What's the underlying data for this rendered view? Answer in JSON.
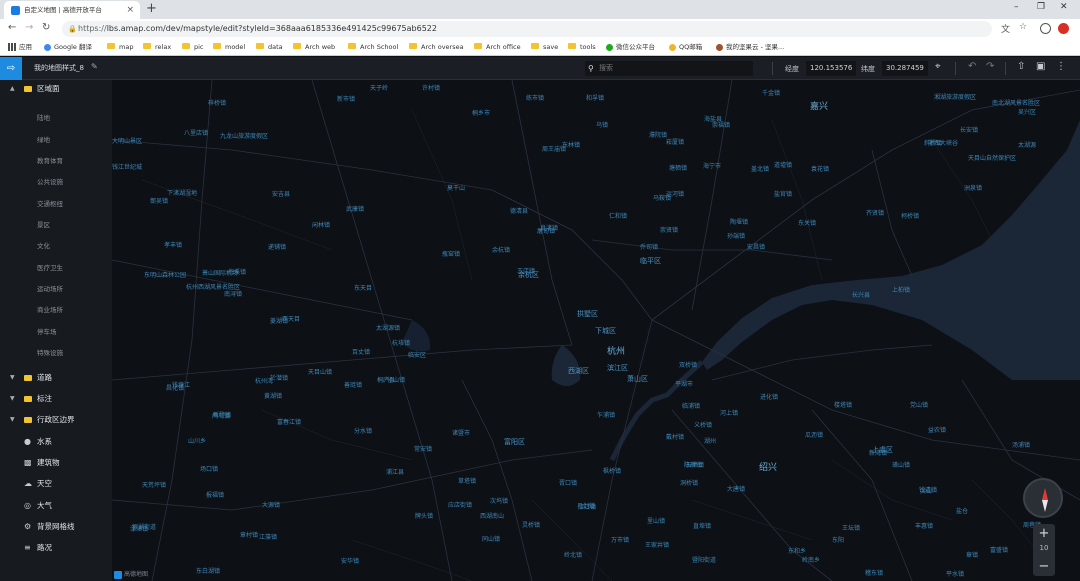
{
  "browser": {
    "tab_title": "自定义地图 | 高德开放平台",
    "tab_close": "×",
    "new_tab": "+",
    "window_controls": [
      "–",
      "❐",
      "✕"
    ],
    "url_scheme": "https://",
    "url_rest": "lbs.amap.com/dev/mapstyle/edit?styleId=368aaa6185336e491425c99675ab6522",
    "bookmarks": [
      {
        "label": "应用",
        "type": "apps"
      },
      {
        "label": "Google 翻译",
        "type": "translate"
      },
      {
        "label": "map",
        "type": "folder"
      },
      {
        "label": "relax",
        "type": "folder"
      },
      {
        "label": "pic",
        "type": "folder"
      },
      {
        "label": "model",
        "type": "folder"
      },
      {
        "label": "data",
        "type": "folder"
      },
      {
        "label": "Arch web",
        "type": "folder"
      },
      {
        "label": "Arch School",
        "type": "folder"
      },
      {
        "label": "Arch oversea",
        "type": "folder"
      },
      {
        "label": "Arch office",
        "type": "folder"
      },
      {
        "label": "save",
        "type": "folder"
      },
      {
        "label": "tools",
        "type": "folder"
      },
      {
        "label": "微信公众平台",
        "type": "wechat"
      },
      {
        "label": "QQ邮箱",
        "type": "qqmail"
      },
      {
        "label": "我的坚果云 - 坚果...",
        "type": "nutstore"
      }
    ]
  },
  "toolbar": {
    "style_name": "我的地图样式_8",
    "search_placeholder": "搜索",
    "lng_label": "经度",
    "lng_value": "120.153576",
    "lat_label": "纬度",
    "lat_value": "30.287459"
  },
  "sidebar": {
    "region_group": "区域面",
    "region_items": [
      "陆地",
      "绿地",
      "教育体育",
      "公共设施",
      "交通枢纽",
      "景区",
      "文化",
      "医疗卫生",
      "运动场所",
      "商业场所",
      "停车场",
      "特殊设施"
    ],
    "groups": [
      "道路",
      "标注",
      "行政区边界"
    ],
    "layers": [
      {
        "label": "水系",
        "icon": "water-drop-icon"
      },
      {
        "label": "建筑物",
        "icon": "building-icon"
      },
      {
        "label": "天空",
        "icon": "cloud-icon"
      },
      {
        "label": "大气",
        "icon": "atmosphere-icon"
      },
      {
        "label": "背景网格线",
        "icon": "grid-icon"
      },
      {
        "label": "路况",
        "icon": "traffic-icon"
      }
    ]
  },
  "map": {
    "cities": [
      "嘉兴",
      "杭州",
      "绍兴"
    ],
    "districts": [
      "临平区",
      "拱墅区",
      "下城区",
      "萧山区",
      "余杭区",
      "西湖区",
      "滨江区",
      "上虞区",
      "富阳区"
    ],
    "places": [
      "梓桥镇",
      "新市镇",
      "天子岭",
      "练市镇",
      "和孚镇",
      "东林镇",
      "德清县",
      "莫干山",
      "安吉县",
      "武康镇",
      "孝丰镇",
      "梅溪镇",
      "递铺镇",
      "鄣吴镇",
      "良渚镇",
      "塘栖镇",
      "运河镇",
      "仁和镇",
      "崇贤镇",
      "乔司镇",
      "余杭镇",
      "闲林镇",
      "瓶窑镇",
      "径山镇",
      "黄湖镇",
      "鸬鸟镇",
      "百丈镇",
      "太湖源镇",
      "临安区",
      "於潜镇",
      "天目山镇",
      "昌化镇",
      "桐庐县",
      "分水镇",
      "富春江镇",
      "新登镇",
      "场口镇",
      "常安镇",
      "浦江县",
      "诸暨市",
      "枫桥镇",
      "次坞镇",
      "店口镇",
      "临浦镇",
      "义桥镇",
      "河上镇",
      "戴村镇",
      "进化镇",
      "楼塔镇",
      "瓜沥镇",
      "党山镇",
      "益农镇",
      "新湾镇",
      "钱清镇",
      "柯桥镇",
      "齐贤镇",
      "安昌镇",
      "马鞍镇",
      "孙端镇",
      "陶堰镇",
      "东关镇",
      "道墟镇",
      "崧厦镇",
      "盖北镇",
      "海盐县",
      "海宁市",
      "盐官镇",
      "袁花镇",
      "斜桥镇",
      "长安镇",
      "许村镇",
      "周王庙镇",
      "桐乡市",
      "乌镇",
      "濮院镇",
      "崇福镇",
      "洲泉镇",
      "屠甸镇",
      "王店镇",
      "双桥镇",
      "平湖市",
      "乍浦镇",
      "湖州",
      "长兴县",
      "南浔镇",
      "菱湖镇",
      "千金镇",
      "善琏镇",
      "八里店镇",
      "九龙山旅游度假区",
      "下渚湖湿地",
      "东明山森林公园",
      "杭州西湖风景名胜区",
      "萧山国际机场",
      "钱江世纪城",
      "大明山景区",
      "湘湖旅游度假区",
      "南北湖风景名胜区",
      "太湖源",
      "浙西大峡谷",
      "天目山自然保护区",
      "吴兴区",
      "上柏镇",
      "东天目",
      "西天目",
      "杭垓镇",
      "报福镇",
      "天荒坪镇",
      "山川乡",
      "章村镇",
      "杭州湾",
      "钱塘江",
      "东阳",
      "尖山",
      "盐仓",
      "周巷镇",
      "丰惠镇",
      "章镇",
      "王坛镇",
      "稽东镇",
      "平水镇",
      "富盛镇",
      "汤浦镇",
      "岭南乡",
      "陈蔡镇",
      "璜山镇",
      "东和乡",
      "大唐镇",
      "岭北镇",
      "王家井镇",
      "暨阳街道",
      "直埠镇",
      "五泄镇",
      "马剑镇",
      "应店街镇",
      "同山镇",
      "牌头镇",
      "安华镇",
      "草塔镇",
      "江藻镇",
      "东白湖镇",
      "西湖南山",
      "灵桥镇",
      "胥口镇",
      "洞桥镇",
      "万市镇",
      "里山镇",
      "渌渚镇",
      "大源镇",
      "银湖街道",
      "受降镇",
      "上官乡",
      "新桐乡",
      "环山乡",
      "湖源乡",
      "龙门镇",
      "东坞山",
      "凤川街道"
    ],
    "zoom_level": "10",
    "logo_text": "高德地图"
  }
}
